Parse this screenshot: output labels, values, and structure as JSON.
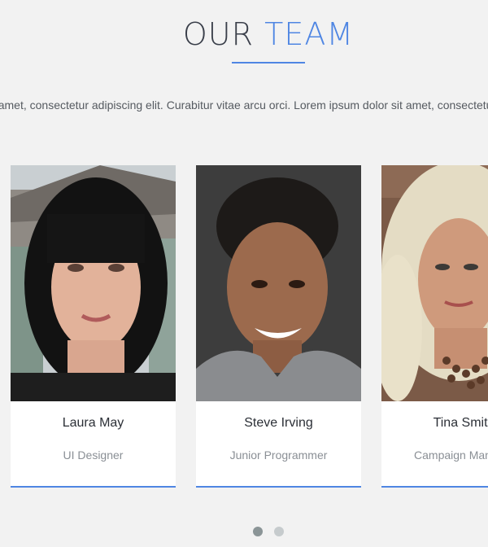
{
  "section": {
    "title_part1": "OUR",
    "title_part2": "TEAM",
    "intro": "Lorem ipsum dolor sit amet, consectetur adipiscing elit. Curabitur vitae arcu orci. Lorem ipsum dolor sit amet, consectetur adipiscing"
  },
  "team": [
    {
      "name": "Laura May",
      "role": "UI Designer"
    },
    {
      "name": "Steve Irving",
      "role": "Junior Programmer"
    },
    {
      "name": "Tina Smith",
      "role": "Campaign Manager"
    }
  ],
  "carousel": {
    "page_count": 2,
    "active_page": 1
  },
  "colors": {
    "accent": "#4f86e3",
    "background": "#f2f2f2",
    "heading": "#3a3f4a"
  }
}
